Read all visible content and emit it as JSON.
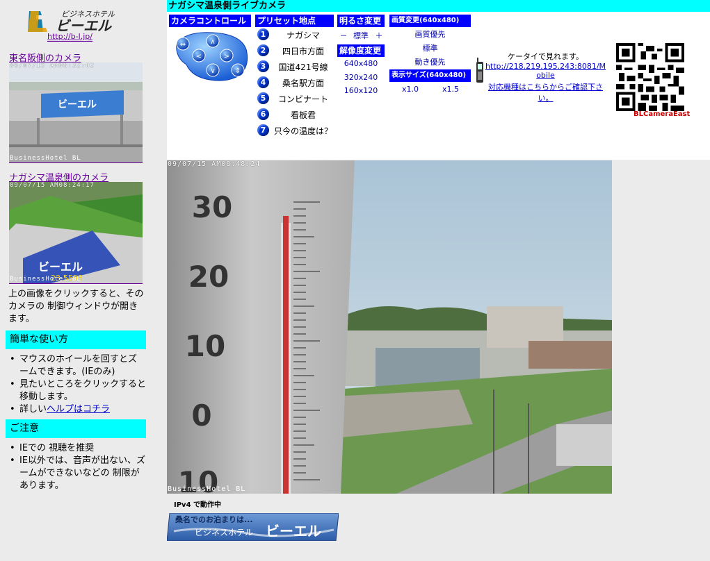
{
  "sidebar": {
    "logo_text": "ビジネスホテル ビーエル",
    "logo_url": "http://b-l.jp/",
    "cam1": {
      "link": "東名阪側のカメラ",
      "stamp": "09/07/15 AM08:32:02",
      "footer": "BusinessHotel BL"
    },
    "cam2": {
      "link": "ナガシマ温泉側のカメラ",
      "stamp": "09/07/15 AM08:24:17",
      "footer": "BusinessHotel BL"
    },
    "click_note": "上の画像をクリックすると、そのカメラの 制御ウィンドウが開きます。",
    "usage": {
      "heading": "簡単な使い方",
      "items": [
        "マウスのホイールを回すとズームできます。(IEのみ)",
        "見たいところをクリックすると移動します。"
      ],
      "help_prefix": "詳しい",
      "help_link": "ヘルプはコチラ"
    },
    "notice": {
      "heading": "ご注意",
      "items": [
        "IEでの 視聴を推奨",
        "IE以外では、音声が出ない、ズームができないなどの 制限があります。"
      ]
    }
  },
  "main": {
    "title": "ナガシマ温泉側ライブカメラ",
    "camera_control": {
      "heading": "カメラコントロール"
    },
    "presets": {
      "heading": "プリセット地点",
      "items": [
        {
          "num": "1",
          "label": "ナガシマ"
        },
        {
          "num": "2",
          "label": "四日市方面"
        },
        {
          "num": "3",
          "label": "国道421号線"
        },
        {
          "num": "4",
          "label": "桑名駅方面"
        },
        {
          "num": "5",
          "label": "コンビナート"
        },
        {
          "num": "6",
          "label": "看板君"
        },
        {
          "num": "7",
          "label": "只今の温度は？"
        }
      ]
    },
    "brightness": {
      "heading": "明るさ変更",
      "minus": "－",
      "standard": "標準",
      "plus": "＋"
    },
    "resolution": {
      "heading": "解像度変更",
      "options": [
        "640x480",
        "320x240",
        "160x120"
      ]
    },
    "quality": {
      "heading": "画質変更(640x480)",
      "options": [
        "画質優先",
        "標準",
        "動き優先"
      ]
    },
    "display_size": {
      "heading": "表示サイズ(640x480)",
      "options": [
        "x1.0",
        "x1.5"
      ]
    },
    "mobile": {
      "text": "ケータイで見れます。",
      "url": "http://218.219.195.243:8081/Mobile",
      "check_link": "対応機種はこちらからご確認下さい。",
      "qr_label": "BLCameraEast"
    },
    "camera": {
      "stamp": "09/07/15 AM08:48:24",
      "footer": "BusinessHotel BL",
      "scale_marks": [
        "30",
        "20",
        "10",
        "0",
        "10"
      ]
    },
    "status": "IPv4 で動作中",
    "banner": {
      "line1": "桑名でのお泊まりは...",
      "line2": "ビジネスホテル",
      "brand": "ビーエル"
    }
  }
}
